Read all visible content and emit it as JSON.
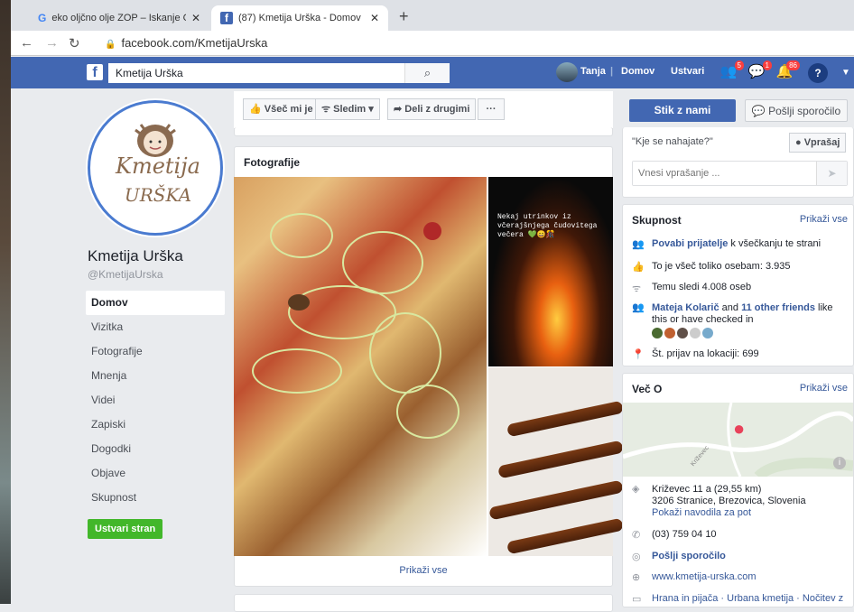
{
  "browser": {
    "tabs": [
      {
        "title": "eko oljčno olje ZOP – Iskanje Go",
        "favicon": "google-icon"
      },
      {
        "title": "(87) Kmetija Urška - Domov",
        "favicon": "facebook-icon"
      }
    ],
    "url": "facebook.com/KmetijaUrska"
  },
  "fb_header": {
    "search_value": "Kmetija Urška",
    "user_name": "Tanja",
    "nav_home": "Domov",
    "nav_create": "Ustvari",
    "badges": {
      "friends": "5",
      "messages": "1",
      "notifications": "86"
    }
  },
  "page": {
    "name": "Kmetija Urška",
    "username": "@KmetijaUrska",
    "logo_text_1": "Kmetija",
    "logo_text_2": "URŠKA",
    "nav": [
      "Domov",
      "Vizitka",
      "Fotografije",
      "Mnenja",
      "Videi",
      "Zapiski",
      "Dogodki",
      "Objave",
      "Skupnost"
    ],
    "create_page": "Ustvari stran"
  },
  "actions": {
    "like": "Všeč mi je",
    "follow": "Sledim",
    "share": "Deli z drugimi",
    "more": "···"
  },
  "photos": {
    "title": "Fotografije",
    "fire_caption": "Nekaj utrinkov iz včerajšnjega čudovitega večera 💚😄🎊",
    "show_all": "Prikaži vse"
  },
  "right": {
    "contact_button": "Stik z nami",
    "message_button": "Pošlji sporočilo",
    "question_prompt": "\"Kje se nahajate?\"",
    "ask_button": "Vprašaj",
    "question_placeholder": "Vnesi vprašanje ...",
    "community": {
      "title": "Skupnost",
      "show_all": "Prikaži vse",
      "invite_link": "Povabi prijatelje",
      "invite_text": " k všečkanju te strani",
      "likes": "To je všeč toliko osebam: 3.935",
      "followers": "Temu sledi 4.008 oseb",
      "friend_name": "Mateja Kolarič",
      "friend_and": " and ",
      "friend_others": "11 other friends",
      "friend_suffix": " like this or have checked in",
      "checkins": "Št. prijav na lokaciji: 699"
    },
    "about": {
      "title": "Več O",
      "show_all": "Prikaži vse",
      "map_road": "Križevec",
      "address_line1": "Križevec 11 a (29,55 km)",
      "address_line2": "3206 Stranice, Brezovica, Slovenia",
      "directions": "Pokaži navodila za pot",
      "phone": "(03) 759 04 10",
      "send_message": "Pošlji sporočilo",
      "website": "www.kmetija-urska.com",
      "category": "Hrana in pijača · Urbana kmetija · Nočitev z"
    }
  }
}
